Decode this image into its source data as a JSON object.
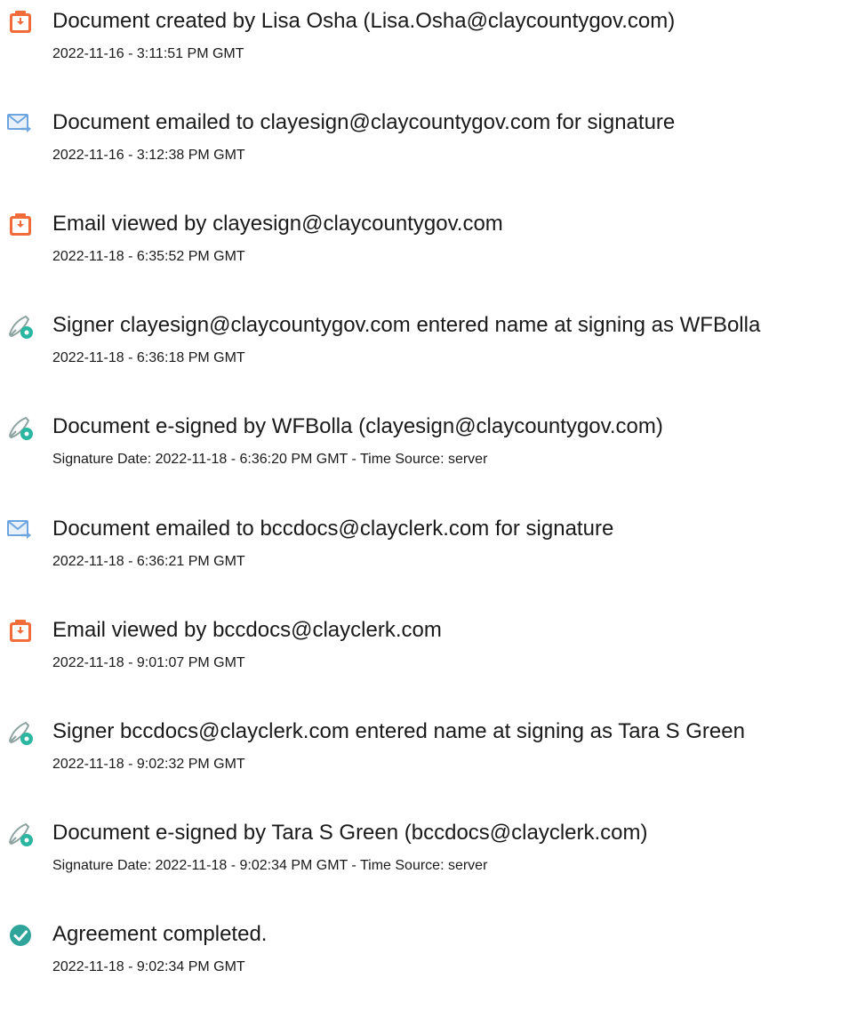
{
  "events": [
    {
      "icon": "document-icon",
      "title": "Document created by Lisa Osha (Lisa.Osha@claycountygov.com)",
      "detail": "2022-11-16 - 3:11:51 PM GMT"
    },
    {
      "icon": "email-sent-icon",
      "title": "Document emailed to clayesign@claycountygov.com for signature",
      "detail": "2022-11-16 - 3:12:38 PM GMT"
    },
    {
      "icon": "document-icon",
      "title": "Email viewed by clayesign@claycountygov.com",
      "detail": "2022-11-18 - 6:35:52 PM GMT"
    },
    {
      "icon": "esign-pen-icon",
      "title": "Signer clayesign@claycountygov.com entered name at signing as WFBolla",
      "detail": "2022-11-18 - 6:36:18 PM GMT"
    },
    {
      "icon": "esign-pen-icon",
      "title": "Document e-signed by WFBolla (clayesign@claycountygov.com)",
      "detail": "Signature Date: 2022-11-18 - 6:36:20 PM GMT - Time Source: server"
    },
    {
      "icon": "email-sent-icon",
      "title": "Document emailed to bccdocs@clayclerk.com for signature",
      "detail": "2022-11-18 - 6:36:21 PM GMT"
    },
    {
      "icon": "document-icon",
      "title": "Email viewed by bccdocs@clayclerk.com",
      "detail": "2022-11-18 - 9:01:07 PM GMT"
    },
    {
      "icon": "esign-pen-icon",
      "title": "Signer bccdocs@clayclerk.com entered name at signing as Tara S Green",
      "detail": "2022-11-18 - 9:02:32 PM GMT"
    },
    {
      "icon": "esign-pen-icon",
      "title": "Document e-signed by Tara S Green (bccdocs@clayclerk.com)",
      "detail": "Signature Date: 2022-11-18 - 9:02:34 PM GMT - Time Source: server"
    },
    {
      "icon": "checkmark-circle-icon",
      "title": "Agreement completed.",
      "detail": "2022-11-18 - 9:02:34 PM GMT"
    }
  ],
  "colors": {
    "document_icon": "#f26b3a",
    "email_icon": "#6da5df",
    "esign_icon": "#8ca39f",
    "esign_badge": "#2bb6a1",
    "check_icon": "#2fa49a",
    "text": "#1a1a1a"
  }
}
